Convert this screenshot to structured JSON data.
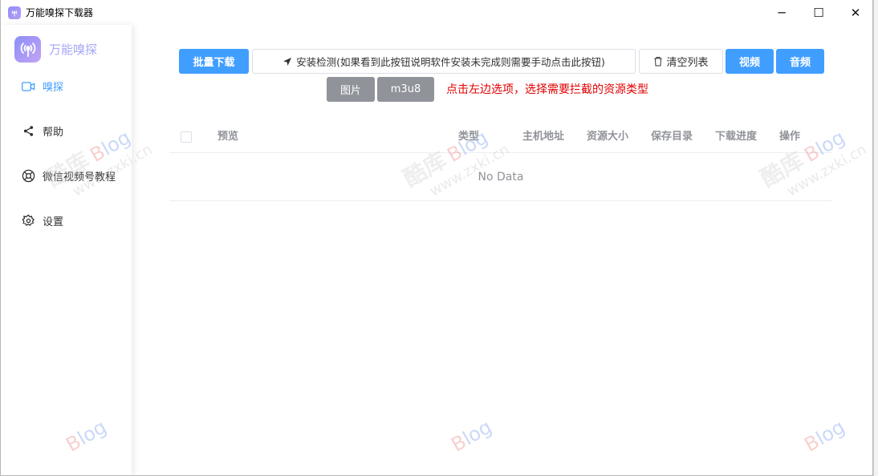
{
  "window": {
    "title": "万能嗅探下载器",
    "minimize_glyph": "─",
    "maximize_glyph": "☐",
    "close_glyph": "✕"
  },
  "sidebar": {
    "logo_text": "万能嗅探",
    "items": [
      {
        "label": "嗅探",
        "icon": "video-camera-icon"
      },
      {
        "label": "帮助",
        "icon": "share-icon"
      },
      {
        "label": "微信视频号教程",
        "icon": "lifebuoy-icon"
      },
      {
        "label": "设置",
        "icon": "gear-icon"
      }
    ]
  },
  "toolbar": {
    "batch_download": "批量下载",
    "install_check": "安装检测(如果看到此按钮说明软件安装未完成则需要手动点击此按钮)",
    "clear_list": "清空列表",
    "video": "视频",
    "audio": "音频",
    "image": "图片",
    "m3u8": "m3u8",
    "hint": "点击左边选项，选择需要拦截的资源类型"
  },
  "table": {
    "columns": [
      "预览",
      "类型",
      "主机地址",
      "资源大小",
      "保存目录",
      "下载进度",
      "操作"
    ],
    "empty_text": "No Data"
  },
  "watermark": {
    "cn": "酷库",
    "brand_b": "B",
    "brand_log": "log",
    "url": "www.zxki.cn"
  },
  "colors": {
    "primary": "#409eff",
    "gray_button": "#909399",
    "hint": "#e00000",
    "logo_gradient_start": "#8b8ff9",
    "logo_gradient_end": "#c3a3f4"
  }
}
